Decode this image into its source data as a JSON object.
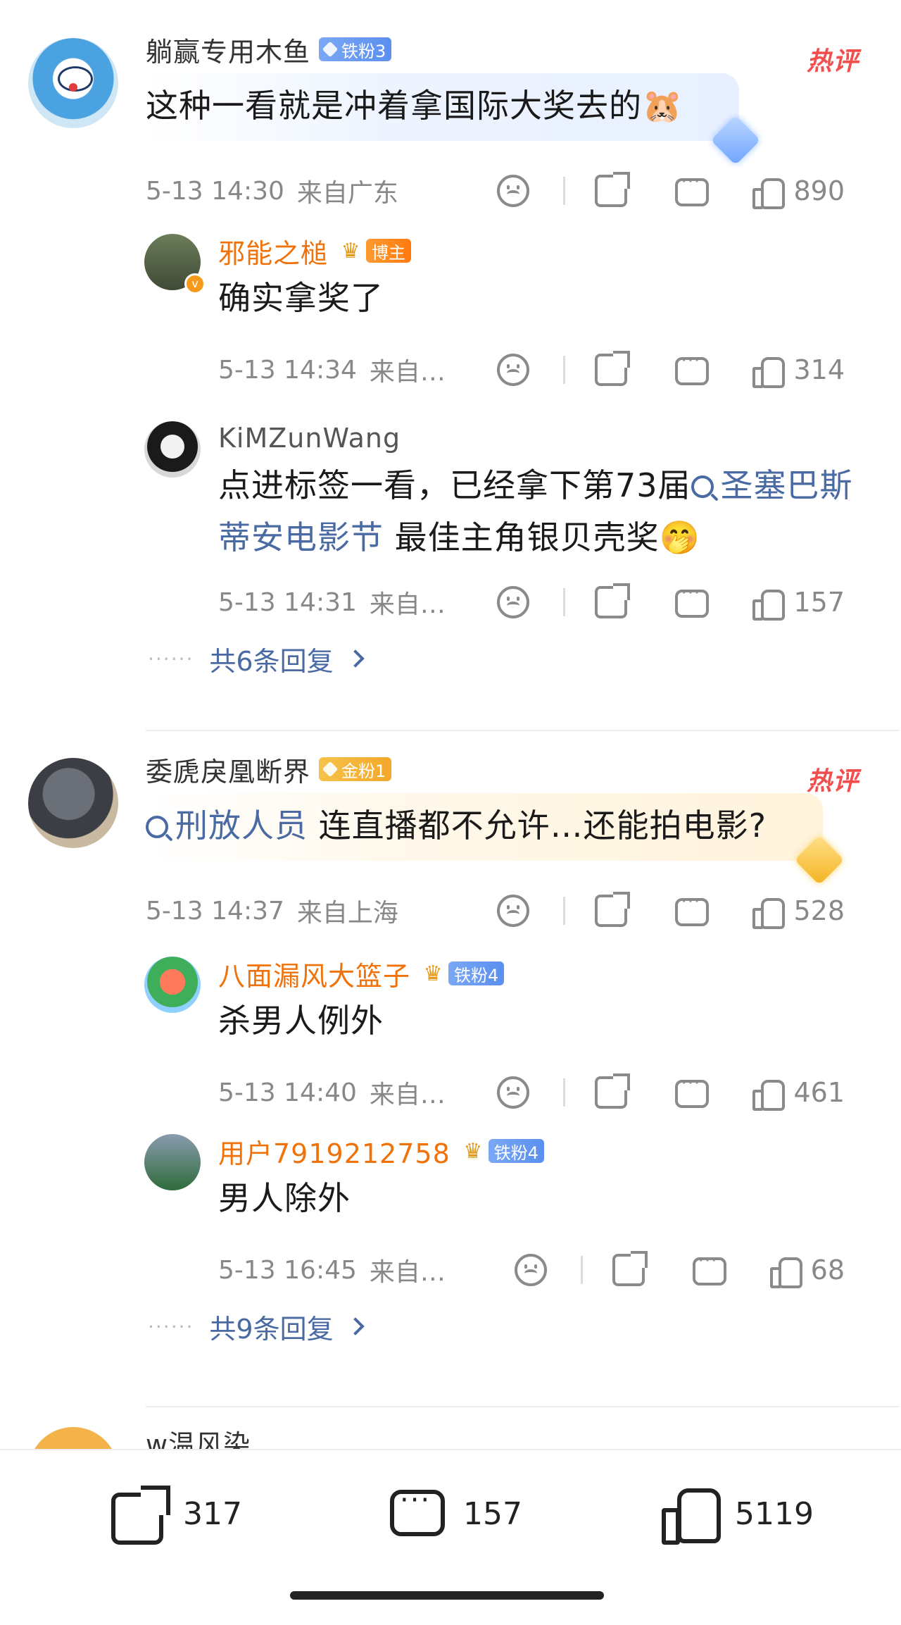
{
  "comments": [
    {
      "user": "躺赢专用木鱼",
      "badge": "铁粉3",
      "hot": "热评",
      "text": "这种一看就是冲着拿国际大奖去的",
      "emoji": "🐹",
      "time": "5-13 14:30",
      "from": "来自广东",
      "likes": "890",
      "avatar_color": "#4aa3e0",
      "replies": [
        {
          "user": "邪能之槌",
          "badge": "博主",
          "text": "确实拿奖了",
          "time": "5-13 14:34",
          "from": "来自…",
          "likes": "314"
        },
        {
          "user": "KiMZunWang",
          "text_pre": "点进标签一看，已经拿下第73届",
          "link": "圣塞巴斯蒂安电影节",
          "text_post": " 最佳主角银贝壳奖",
          "emoji": "🤭",
          "time": "5-13 14:31",
          "from": "来自…",
          "likes": "157"
        }
      ],
      "more_replies": "共6条回复"
    },
    {
      "user": "委虒戾凰断界",
      "badge": "金粉1",
      "hot": "热评",
      "link": "刑放人员",
      "text": " 连直播都不允许…还能拍电影?",
      "time": "5-13 14:37",
      "from": "来自上海",
      "likes": "528",
      "replies": [
        {
          "user": "八面漏风大篮子",
          "badge": "铁粉4",
          "text": "杀男人例外",
          "time": "5-13 14:40",
          "from": "来自…",
          "likes": "461"
        },
        {
          "user": "用户7919212758",
          "badge": "铁粉4",
          "text": "男人除外",
          "time": "5-13 16:45",
          "from": "来自…",
          "likes": "68"
        }
      ],
      "more_replies": "共9条回复"
    }
  ],
  "peek_user": "w温风染",
  "bottom_bar": {
    "share_count": "317",
    "comment_count": "157",
    "like_count": "5119"
  }
}
